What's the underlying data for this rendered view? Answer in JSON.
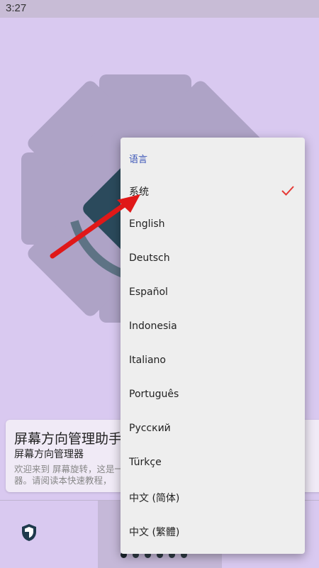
{
  "status_bar": {
    "time": "3:27"
  },
  "card": {
    "title": "屏幕方向管理助手",
    "subtitle": "屏幕方向管理器",
    "description": "欢迎来到 屏幕旋转，这是一个 器。请阅读本快速教程，"
  },
  "menu": {
    "header": "语言",
    "selected_index": 0,
    "items": [
      {
        "label": "系统"
      },
      {
        "label": "English"
      },
      {
        "label": "Deutsch"
      },
      {
        "label": "Español"
      },
      {
        "label": "Indonesia"
      },
      {
        "label": "Italiano"
      },
      {
        "label": "Português"
      },
      {
        "label": "Русский"
      },
      {
        "label": "Türkçe"
      },
      {
        "label": "中文 (简体)"
      },
      {
        "label": "中文 (繁體)"
      }
    ]
  },
  "pager": {
    "page_count": 6,
    "current_page": 0
  },
  "colors": {
    "accent": "#3d57b8",
    "check": "#e53935",
    "arrow": "#e01818",
    "background": "#d9c9f0"
  },
  "icons": [
    "shield-icon",
    "check-icon",
    "gear-illustration"
  ]
}
